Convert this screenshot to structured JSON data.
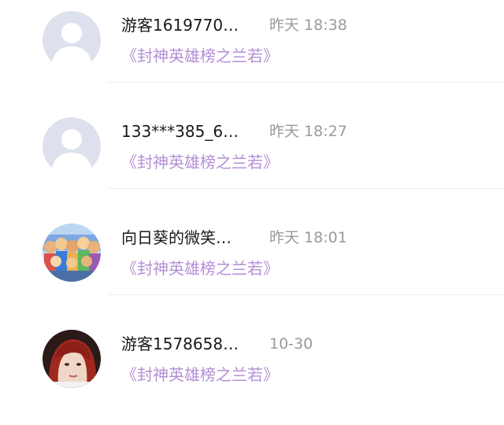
{
  "comments": [
    {
      "user": "游客1619770…",
      "time": "昨天 18:38",
      "book": "《封神英雄榜之兰若》",
      "avatar": "default-avatar-icon"
    },
    {
      "user": "133***385_6…",
      "time": "昨天 18:27",
      "book": "《封神英雄榜之兰若》",
      "avatar": "default-avatar-icon"
    },
    {
      "user": "向日葵的微笑…",
      "time": "昨天 18:01",
      "book": "《封神英雄榜之兰若》",
      "avatar": "cartoon-group-avatar"
    },
    {
      "user": "游客1578658…",
      "time": "10-30",
      "book": "《封神英雄榜之兰若》",
      "avatar": "portrait-avatar"
    }
  ],
  "colors": {
    "book_link": "#b48fd6",
    "time": "#9a9a9a",
    "name": "#1a1a1a",
    "default_avatar_bg": "#dde1ee"
  }
}
